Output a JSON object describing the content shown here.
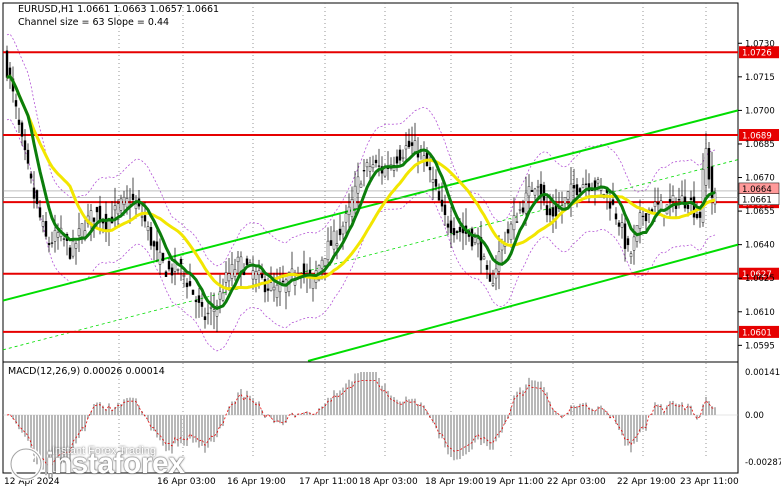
{
  "header": {
    "symbol_line": "EURUSD,H1  1.0661 1.0663 1.0657 1.0661",
    "channel_line": "Channel size = 63 Slope = 0.44"
  },
  "macd": {
    "label": "MACD(12,26,9) 0.00026 0.00014",
    "scale": [
      "0.00141",
      "0.00",
      "-0.00287"
    ]
  },
  "price_axis": {
    "ticks": [
      "1.0730",
      "1.0715",
      "1.0700",
      "1.0685",
      "1.0670",
      "1.0655",
      "1.0640",
      "1.0625",
      "1.0610",
      "1.0595"
    ],
    "ymin": 1.0588,
    "ymax": 1.0748
  },
  "levels": [
    {
      "value": 1.0726,
      "label": "1.0726"
    },
    {
      "value": 1.0689,
      "label": "1.0689"
    },
    {
      "value": 1.0659,
      "label": "1.0659"
    },
    {
      "value": 1.0627,
      "label": "1.0627"
    },
    {
      "value": 1.0601,
      "label": "1.0601"
    }
  ],
  "current_price_tags": [
    {
      "value": 1.0664,
      "label": "1.0664"
    },
    {
      "value": 1.0661,
      "label": "1.0661"
    }
  ],
  "time_axis": [
    "12 Apr 2024",
    "16 Apr 03:00",
    "16 Apr 19:00",
    "17 Apr 11:00",
    "18 Apr 03:00",
    "18 Apr 19:00",
    "19 Apr 11:00",
    "22 Apr 03:00",
    "22 Apr 19:00",
    "23 Apr 11:00"
  ],
  "watermark": {
    "brand": "instaforex",
    "tagline": "Instant Forex Trading"
  },
  "colors": {
    "level_red": "#e60000",
    "channel_green": "#00dd00",
    "ma_green": "#0b7d0b",
    "ma_yellow": "#f2e600",
    "bands": "#b455d6",
    "candle_up": "#ffffff",
    "candle_down": "#000000",
    "macd_signal": "#e60000",
    "macd_hist": "#b8b8b8",
    "grid": "#6a6a6a"
  }
}
